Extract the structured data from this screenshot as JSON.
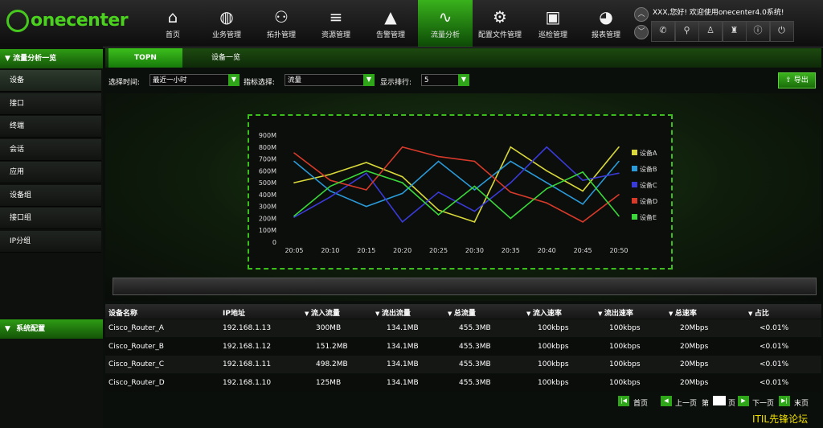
{
  "logo": {
    "text": "onecenter"
  },
  "nav": [
    {
      "label": "首页",
      "icon": "home-icon",
      "active": false
    },
    {
      "label": "业务管理",
      "icon": "globe-icon",
      "active": false
    },
    {
      "label": "拓扑管理",
      "icon": "topology-icon",
      "active": false
    },
    {
      "label": "资源管理",
      "icon": "database-icon",
      "active": false
    },
    {
      "label": "告警管理",
      "icon": "warning-icon",
      "active": false
    },
    {
      "label": "流量分析",
      "icon": "pulse-icon",
      "active": true
    },
    {
      "label": "配置文件管理",
      "icon": "config-file-icon",
      "active": false
    },
    {
      "label": "巡检管理",
      "icon": "inspection-box-icon",
      "active": false
    },
    {
      "label": "报表管理",
      "icon": "report-pie-icon",
      "active": false
    }
  ],
  "header": {
    "greeting": "XXX,您好!  欢迎使用onecenter4.0系统!",
    "tools": [
      "phone-icon",
      "search-icon",
      "user-icon",
      "shirt-icon",
      "info-icon",
      "power-icon"
    ]
  },
  "sidebar": {
    "section1_title": "流量分析一览",
    "items": [
      {
        "label": "设备",
        "selected": true
      },
      {
        "label": "接口",
        "selected": false
      },
      {
        "label": "终端",
        "selected": false
      },
      {
        "label": "会话",
        "selected": false
      },
      {
        "label": "应用",
        "selected": false
      },
      {
        "label": "设备组",
        "selected": false
      },
      {
        "label": "接口组",
        "selected": false
      },
      {
        "label": "IP分组",
        "selected": false
      }
    ],
    "section2_title": "系统配置"
  },
  "tabs": [
    {
      "label": "TOPN",
      "active": true
    },
    {
      "label": "设备一览",
      "active": false
    }
  ],
  "filters": {
    "time_label": "选择时间:",
    "time_value": "最近一小时",
    "metric_label": "指标选择:",
    "metric_value": "流量",
    "rank_label": "显示排行:",
    "rank_value": "5"
  },
  "export_label": "导出",
  "chart_data": {
    "type": "line",
    "categories": [
      "20:05",
      "20:10",
      "20:15",
      "20:20",
      "20:25",
      "20:30",
      "20:35",
      "20:40",
      "20:45",
      "20:50"
    ],
    "yticks": [
      "900M",
      "800M",
      "700M",
      "600M",
      "500M",
      "400M",
      "300M",
      "200M",
      "100M",
      "0"
    ],
    "ylim": [
      0,
      900
    ],
    "colors": [
      "#d8d83a",
      "#2a9ad8",
      "#3a3ad8",
      "#d83a2a",
      "#3ad83a"
    ],
    "legend_position": "right",
    "series": [
      {
        "name": "设备A",
        "values": [
          500,
          570,
          670,
          550,
          270,
          170,
          800,
          600,
          430,
          800
        ]
      },
      {
        "name": "设备B",
        "values": [
          680,
          430,
          300,
          410,
          680,
          440,
          680,
          500,
          320,
          680
        ]
      },
      {
        "name": "设备C",
        "values": [
          210,
          380,
          580,
          170,
          420,
          260,
          500,
          800,
          520,
          580
        ]
      },
      {
        "name": "设备D",
        "values": [
          750,
          520,
          440,
          800,
          720,
          680,
          420,
          330,
          170,
          400
        ]
      },
      {
        "name": "设备E",
        "values": [
          220,
          470,
          600,
          500,
          230,
          470,
          200,
          450,
          590,
          220
        ]
      }
    ]
  },
  "table": {
    "headers": [
      "设备名称",
      "IP地址",
      "流入流量",
      "流出流量",
      "总流量",
      "流入速率",
      "流出速率",
      "总速率",
      "占比"
    ],
    "rows": [
      [
        "Cisco_Router_A",
        "192.168.1.13",
        "300MB",
        "134.1MB",
        "455.3MB",
        "100kbps",
        "100kbps",
        "20Mbps",
        "<0.01%"
      ],
      [
        "Cisco_Router_B",
        "192.168.1.12",
        "151.2MB",
        "134.1MB",
        "455.3MB",
        "100kbps",
        "100kbps",
        "20Mbps",
        "<0.01%"
      ],
      [
        "Cisco_Router_C",
        "192.168.1.11",
        "498.2MB",
        "134.1MB",
        "455.3MB",
        "100kbps",
        "100kbps",
        "20Mbps",
        "<0.01%"
      ],
      [
        "Cisco_Router_D",
        "192.168.1.10",
        "125MB",
        "134.1MB",
        "455.3MB",
        "100kbps",
        "100kbps",
        "20Mbps",
        "<0.01%"
      ]
    ]
  },
  "pager": {
    "first": "首页",
    "prev": "上一页",
    "page_prefix": "第",
    "page_suffix": "页",
    "next": "下一页",
    "last": "末页"
  },
  "watermark": "ITIL先锋论坛"
}
